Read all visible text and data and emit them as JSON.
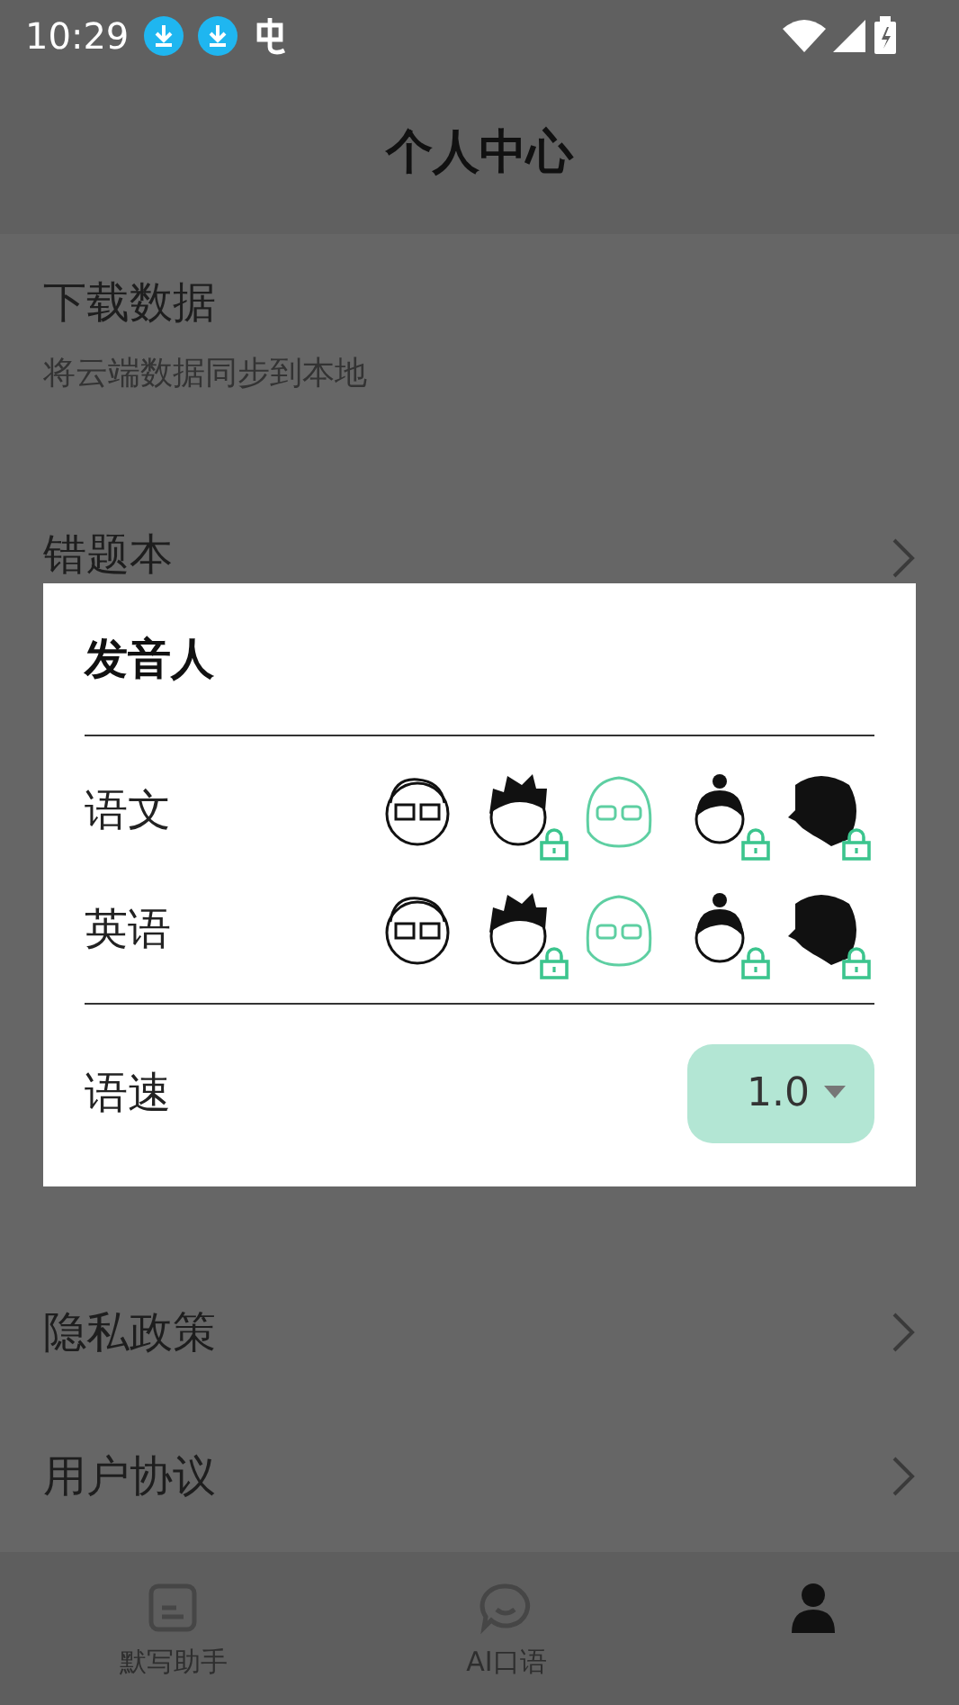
{
  "status_bar": {
    "time": "10:29"
  },
  "header": {
    "title": "个人中心"
  },
  "menu": [
    {
      "title": "下载数据",
      "subtitle": "将云端数据同步到本地",
      "chevron": false,
      "kind": "top"
    },
    {
      "title": "错题本",
      "chevron": true,
      "kind": "top"
    },
    {
      "title": "隐私政策",
      "chevron": true,
      "kind": "bottom"
    },
    {
      "title": "用户协议",
      "chevron": true,
      "kind": "bottom"
    }
  ],
  "dialog": {
    "title": "发音人",
    "rows": [
      {
        "label": "语文",
        "voices": [
          {
            "kind": "glasses-man",
            "locked": false,
            "selected": false
          },
          {
            "kind": "spiky-boy",
            "locked": true,
            "selected": false
          },
          {
            "kind": "glasses-woman",
            "locked": false,
            "selected": true
          },
          {
            "kind": "bun-girl",
            "locked": true,
            "selected": false
          },
          {
            "kind": "profile",
            "locked": true,
            "selected": false
          }
        ]
      },
      {
        "label": "英语",
        "voices": [
          {
            "kind": "glasses-man",
            "locked": false,
            "selected": false
          },
          {
            "kind": "spiky-boy",
            "locked": true,
            "selected": false
          },
          {
            "kind": "glasses-woman",
            "locked": false,
            "selected": true
          },
          {
            "kind": "bun-girl",
            "locked": true,
            "selected": false
          },
          {
            "kind": "profile",
            "locked": true,
            "selected": false
          }
        ]
      }
    ],
    "speed": {
      "label": "语速",
      "value": "1.0"
    }
  },
  "bottom_nav": [
    {
      "label": "默写助手",
      "kind": "note",
      "selected": false
    },
    {
      "label": "AI口语",
      "kind": "chat",
      "selected": false
    },
    {
      "kind": "person",
      "selected": true
    }
  ]
}
